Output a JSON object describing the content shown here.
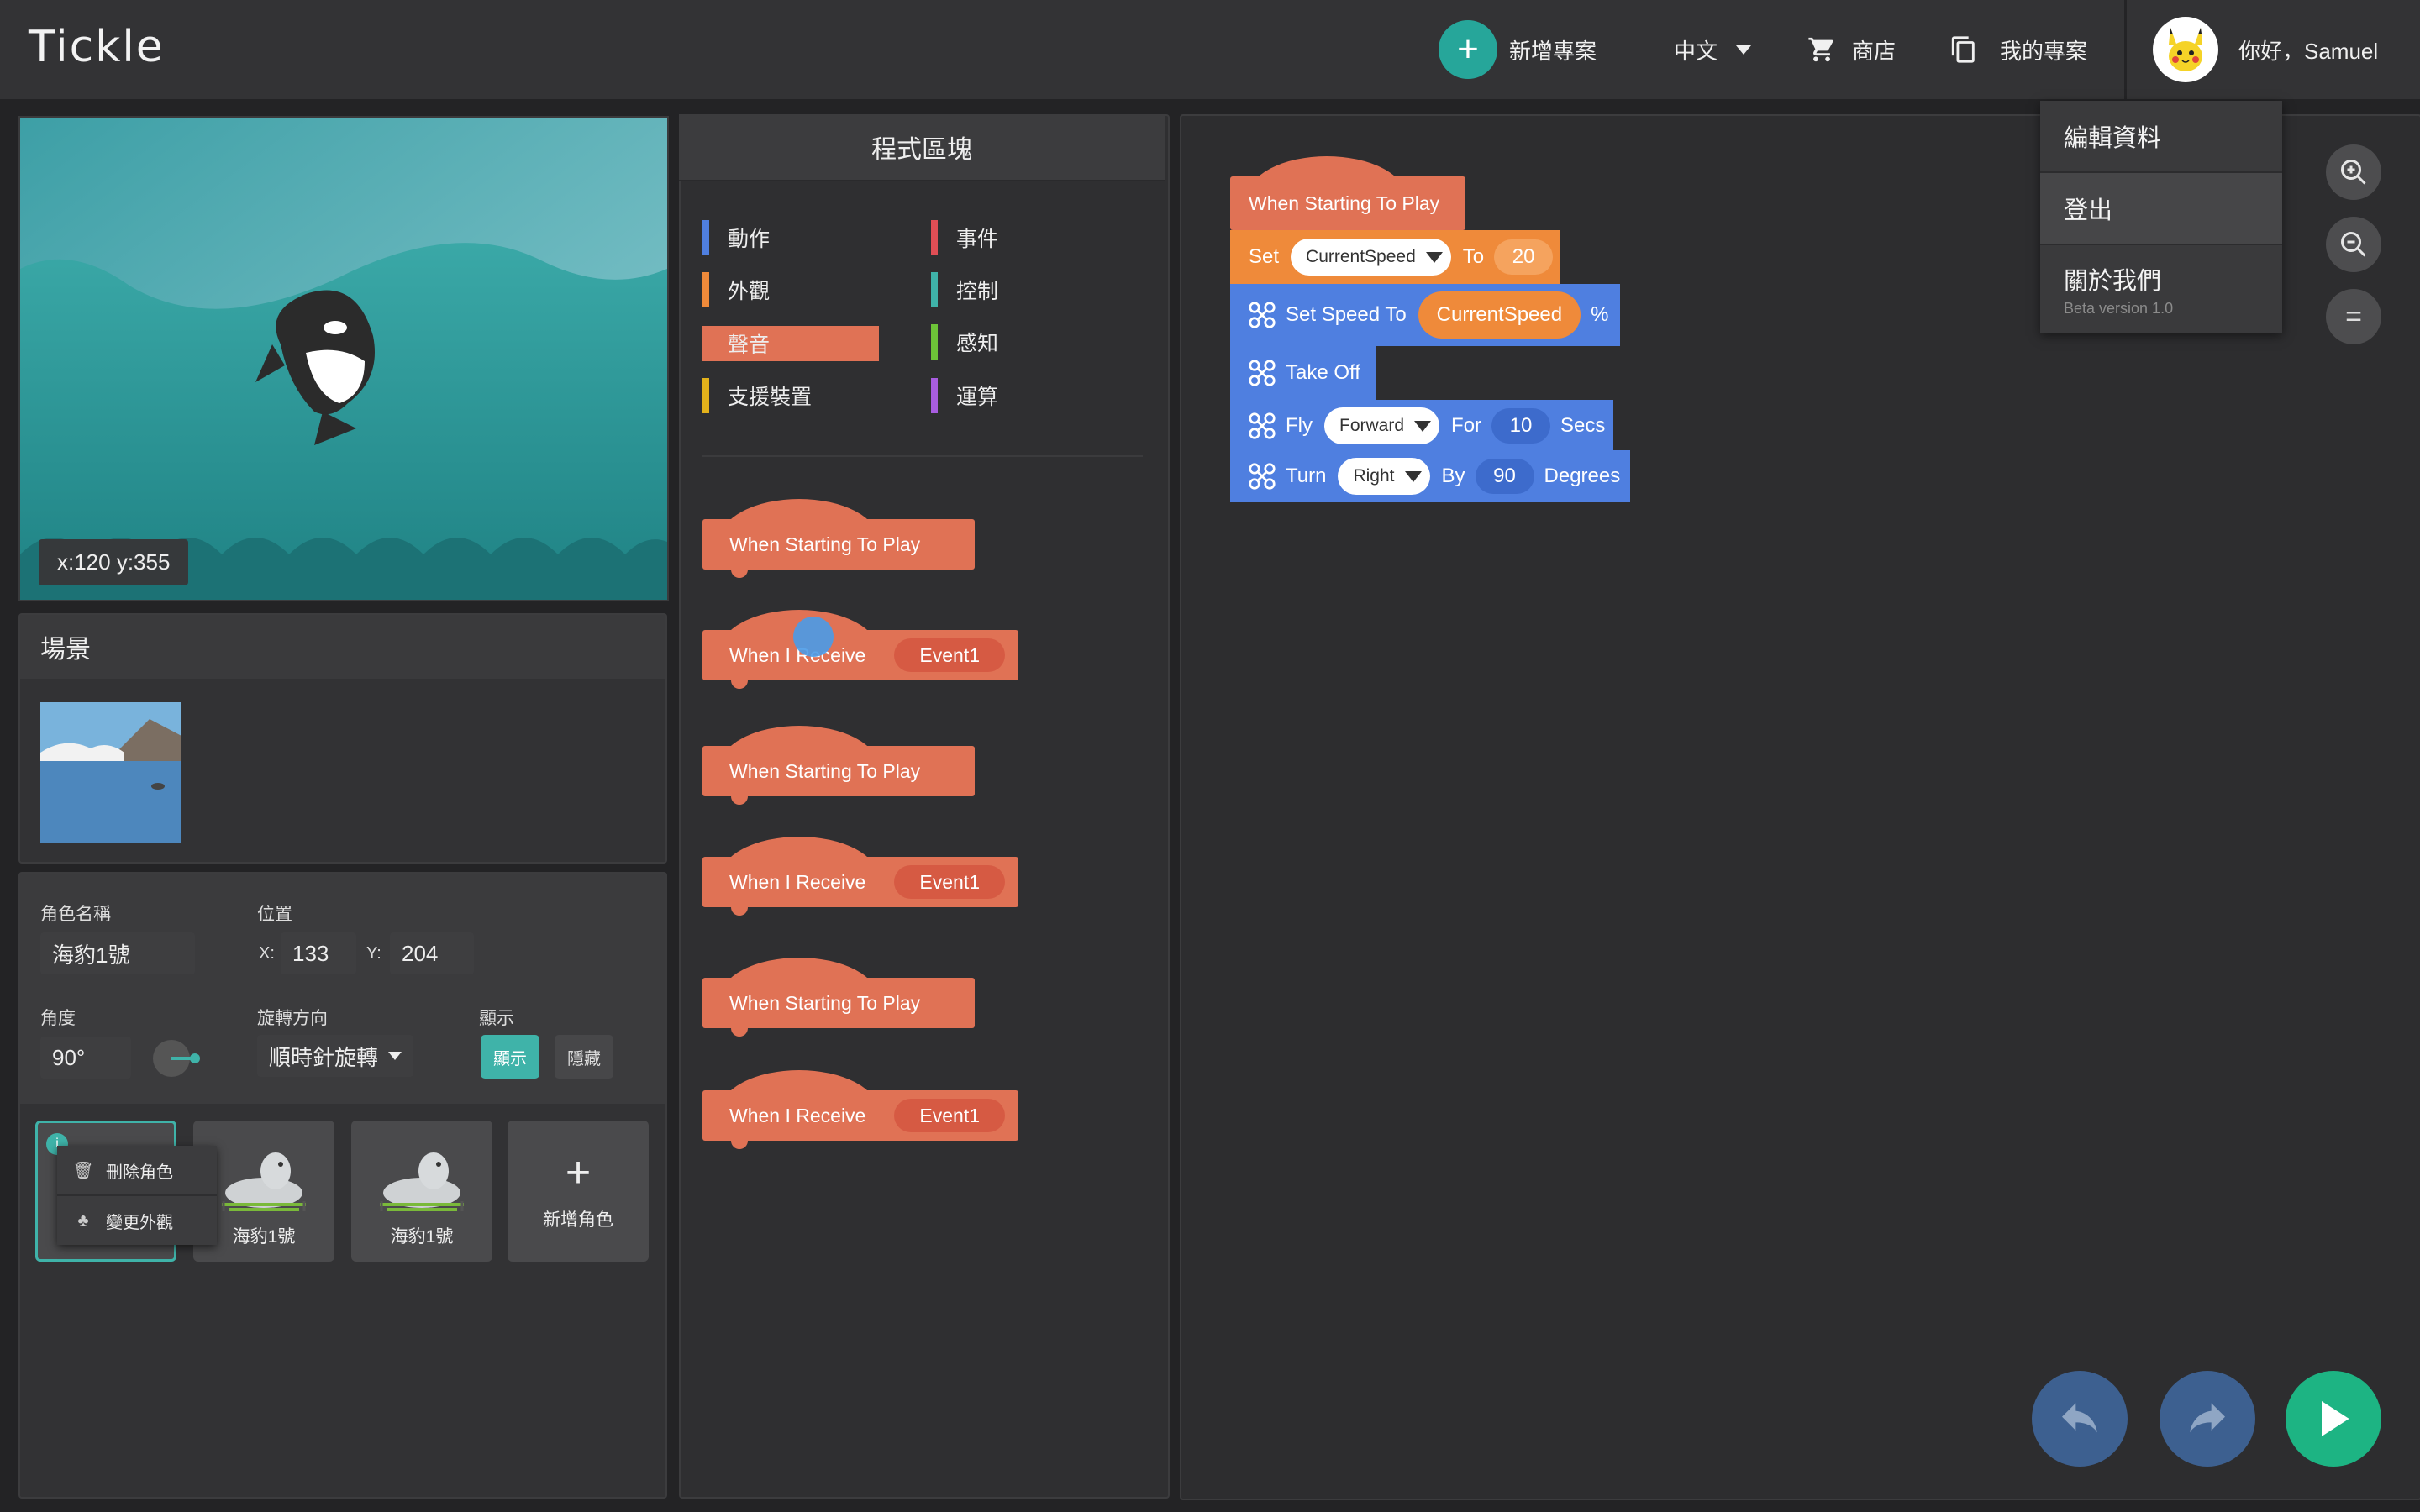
{
  "header": {
    "logo": "Tickle",
    "new_project": "新增專案",
    "language": "中文",
    "shop": "商店",
    "my_projects": "我的專案",
    "greeting": "你好，Samuel"
  },
  "user_menu": {
    "items": [
      "編輯資料",
      "登出",
      "關於我們"
    ],
    "version": "Beta version 1.0"
  },
  "stage": {
    "coords": "x:120 y:355"
  },
  "scene": {
    "title": "場景"
  },
  "sprite": {
    "name_label": "角色名稱",
    "name_value": "海豹1號",
    "position_label": "位置",
    "x_label": "X:",
    "x_value": "133",
    "y_label": "Y:",
    "y_value": "204",
    "angle_label": "角度",
    "angle_value": "90°",
    "rotation_label": "旋轉方向",
    "rotation_value": "順時針旋轉",
    "display_label": "顯示",
    "show_label": "顯示",
    "hide_label": "隱藏"
  },
  "sprites": {
    "cards": [
      "海豹1號",
      "海豹1號"
    ],
    "add_label": "新增角色",
    "context_menu": [
      "刪除角色",
      "變更外觀"
    ]
  },
  "palette": {
    "title": "程式區塊",
    "categories_left": [
      {
        "label": "動作",
        "color": "#4f7fe0"
      },
      {
        "label": "外觀",
        "color": "#ef8a3a"
      },
      {
        "label": "聲音",
        "color": "#e07255"
      },
      {
        "label": "支援裝置",
        "color": "#e3b21b"
      }
    ],
    "categories_right": [
      {
        "label": "事件",
        "color": "#e04e55"
      },
      {
        "label": "控制",
        "color": "#3fb3a9"
      },
      {
        "label": "感知",
        "color": "#6dc438"
      },
      {
        "label": "運算",
        "color": "#a85de0"
      }
    ],
    "blocks": [
      {
        "text": "When Starting To Play"
      },
      {
        "text": "When I Receive",
        "event": "Event1"
      },
      {
        "text": "When Starting To Play"
      },
      {
        "text": "When I Receive",
        "event": "Event1"
      },
      {
        "text": "When Starting To Play"
      },
      {
        "text": "When I Receive",
        "event": "Event1"
      }
    ]
  },
  "script": {
    "hat": "When Starting To Play",
    "set": {
      "kw": "Set",
      "var": "CurrentSpeed",
      "to": "To",
      "value": "20"
    },
    "speed": {
      "kw": "Set Speed To",
      "var": "CurrentSpeed",
      "unit": "%"
    },
    "takeoff": "Take Off",
    "fly": {
      "kw": "Fly",
      "dir": "Forward",
      "for": "For",
      "value": "10",
      "unit": "Secs"
    },
    "turn": {
      "kw": "Turn",
      "dir": "Right",
      "by": "By",
      "value": "90",
      "unit": "Degrees"
    }
  },
  "icons": [
    "plus-icon",
    "caret-down-icon",
    "cart-icon",
    "copy-icon",
    "avatar-pikachu",
    "zoom-in-icon",
    "zoom-out-icon",
    "reset-zoom-icon",
    "undo-icon",
    "redo-icon",
    "play-icon",
    "drone-icon",
    "trash-icon",
    "costume-icon",
    "info-icon"
  ]
}
